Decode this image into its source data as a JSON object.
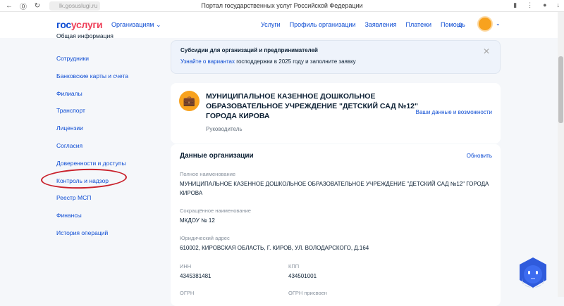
{
  "browser": {
    "url": "lk.gosuslugi.ru",
    "title": "Портал государственных услуг Российской Федерации"
  },
  "header": {
    "logo_a": "гос",
    "logo_b": "услуги",
    "orgs_menu": "Организациям",
    "nav": [
      "Услуги",
      "Профиль организации",
      "Заявления",
      "Платежи",
      "Помощь"
    ]
  },
  "sidebar": {
    "items": [
      "Общая информация",
      "Сотрудники",
      "Банковские карты и счета",
      "Филиалы",
      "Транспорт",
      "Лицензии",
      "Согласия",
      "Доверенности и доступы",
      "Контроль и надзор",
      "Реестр МСП",
      "Финансы",
      "История операций"
    ]
  },
  "banner": {
    "title": "Субсидии для организаций и предпринимателей",
    "link": "Узнайте о вариантах",
    "text": " господдержки в 2025 году и заполните заявку"
  },
  "org": {
    "name": "МУНИЦИПАЛЬНОЕ КАЗЕННОЕ ДОШКОЛЬНОЕ ОБРАЗОВАТЕЛЬНОЕ УЧРЕЖДЕНИЕ \"ДЕТСКИЙ САД №12\" ГОРОДА КИРОВА",
    "role": "Руководитель",
    "your_data": "Ваши данные и возможности"
  },
  "details": {
    "title": "Данные организации",
    "refresh": "Обновить",
    "full_name_label": "Полное наименование",
    "full_name": "МУНИЦИПАЛЬНОЕ КАЗЕННОЕ ДОШКОЛЬНОЕ ОБРАЗОВАТЕЛЬНОЕ УЧРЕЖДЕНИЕ \"ДЕТСКИЙ САД №12\" ГОРОДА КИРОВА",
    "short_name_label": "Сокращённое наименование",
    "short_name": "МКДОУ № 12",
    "address_label": "Юридический адрес",
    "address": "610002, КИРОВСКАЯ ОБЛАСТЬ, Г. КИРОВ, УЛ. ВОЛОДАРСКОГО, Д.164",
    "inn_label": "ИНН",
    "inn": "4345381481",
    "kpp_label": "КПП",
    "kpp": "434501001",
    "ogrn_label": "ОГРН",
    "ogrn_date_label": "ОГРН присвоен"
  }
}
